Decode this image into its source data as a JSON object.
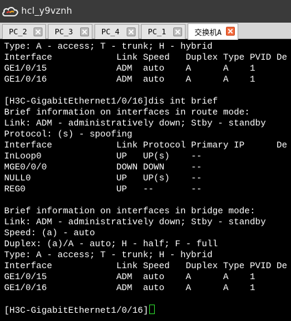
{
  "window": {
    "title": "hcl_y9vznh",
    "icon": "cloud-icon",
    "colors": {
      "titlebar": "#3a3a3a",
      "terminal_bg": "#000000",
      "text": "#ffffff",
      "cursor": "#2bd02b",
      "active_close": "#f46a3c"
    }
  },
  "tabs": [
    {
      "label": "PC_2",
      "active": false
    },
    {
      "label": "PC_3",
      "active": false
    },
    {
      "label": "PC_4",
      "active": false
    },
    {
      "label": "PC_1",
      "active": false
    },
    {
      "label": "交换机A",
      "active": true
    }
  ],
  "terminal": {
    "lines": [
      "Type: A - access; T - trunk; H - hybrid",
      "Interface            Link Speed   Duplex Type PVID De",
      "GE1/0/15             ADM  auto    A      A    1",
      "GE1/0/16             ADM  auto    A      A    1",
      "",
      "[H3C-GigabitEthernet1/0/16]dis int brief",
      "Brief information on interfaces in route mode:",
      "Link: ADM - administratively down; Stby - standby",
      "Protocol: (s) - spoofing",
      "Interface            Link Protocol Primary IP      De",
      "InLoop0              UP   UP(s)    --",
      "MGE0/0/0             DOWN DOWN     --",
      "NULL0                UP   UP(s)    --",
      "REG0                 UP   --       --",
      "",
      "Brief information on interfaces in bridge mode:",
      "Link: ADM - administratively down; Stby - standby",
      "Speed: (a) - auto",
      "Duplex: (a)/A - auto; H - half; F - full",
      "Type: A - access; T - trunk; H - hybrid",
      "Interface            Link Speed   Duplex Type PVID De",
      "GE1/0/15             ADM  auto    A      A    1",
      "GE1/0/16             ADM  auto    A      A    1",
      "",
      "[H3C-GigabitEthernet1/0/16]"
    ]
  }
}
